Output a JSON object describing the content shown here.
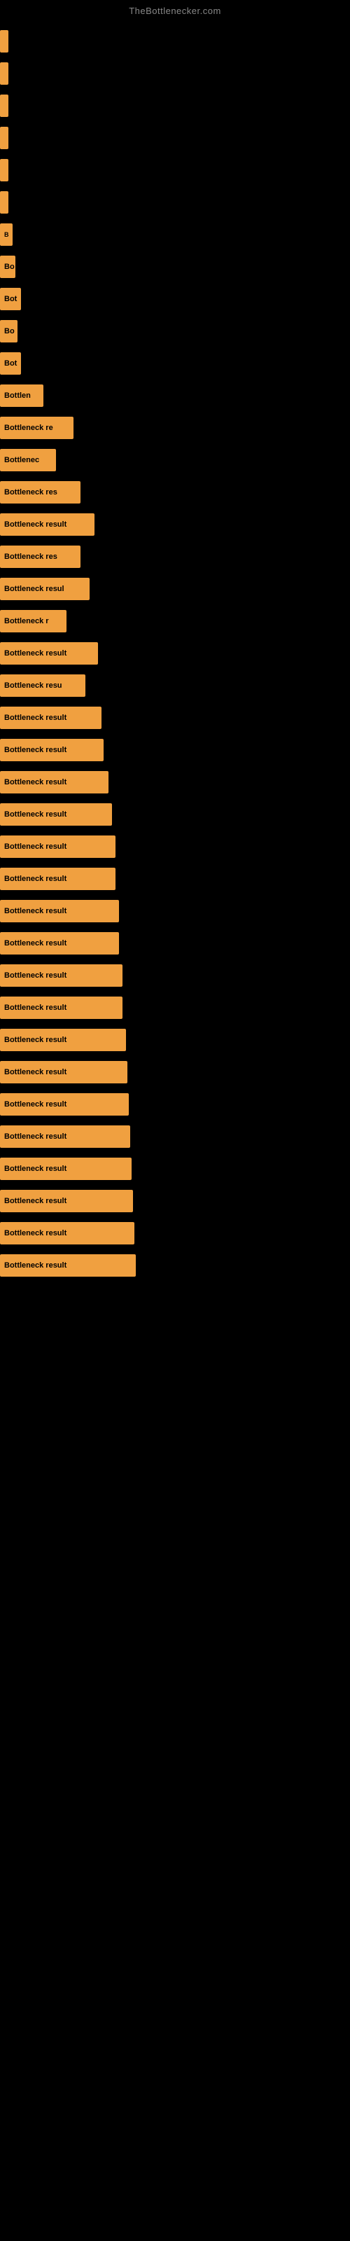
{
  "site": {
    "title": "TheBottlenecker.com"
  },
  "bars": [
    {
      "id": 1,
      "label": "",
      "width": 5
    },
    {
      "id": 2,
      "label": "",
      "width": 8
    },
    {
      "id": 3,
      "label": "",
      "width": 10
    },
    {
      "id": 4,
      "label": "",
      "width": 8
    },
    {
      "id": 5,
      "label": "",
      "width": 8
    },
    {
      "id": 6,
      "label": "",
      "width": 10
    },
    {
      "id": 7,
      "label": "B",
      "width": 18
    },
    {
      "id": 8,
      "label": "Bo",
      "width": 22
    },
    {
      "id": 9,
      "label": "Bot",
      "width": 30
    },
    {
      "id": 10,
      "label": "Bo",
      "width": 25
    },
    {
      "id": 11,
      "label": "Bot",
      "width": 30
    },
    {
      "id": 12,
      "label": "Bottlen",
      "width": 62
    },
    {
      "id": 13,
      "label": "Bottleneck re",
      "width": 105
    },
    {
      "id": 14,
      "label": "Bottlenec",
      "width": 80
    },
    {
      "id": 15,
      "label": "Bottleneck res",
      "width": 115
    },
    {
      "id": 16,
      "label": "Bottleneck result",
      "width": 135
    },
    {
      "id": 17,
      "label": "Bottleneck res",
      "width": 115
    },
    {
      "id": 18,
      "label": "Bottleneck resul",
      "width": 128
    },
    {
      "id": 19,
      "label": "Bottleneck r",
      "width": 95
    },
    {
      "id": 20,
      "label": "Bottleneck result",
      "width": 140
    },
    {
      "id": 21,
      "label": "Bottleneck resu",
      "width": 122
    },
    {
      "id": 22,
      "label": "Bottleneck result",
      "width": 145
    },
    {
      "id": 23,
      "label": "Bottleneck result",
      "width": 148
    },
    {
      "id": 24,
      "label": "Bottleneck result",
      "width": 155
    },
    {
      "id": 25,
      "label": "Bottleneck result",
      "width": 160
    },
    {
      "id": 26,
      "label": "Bottleneck result",
      "width": 165
    },
    {
      "id": 27,
      "label": "Bottleneck result",
      "width": 165
    },
    {
      "id": 28,
      "label": "Bottleneck result",
      "width": 170
    },
    {
      "id": 29,
      "label": "Bottleneck result",
      "width": 170
    },
    {
      "id": 30,
      "label": "Bottleneck result",
      "width": 175
    },
    {
      "id": 31,
      "label": "Bottleneck result",
      "width": 175
    },
    {
      "id": 32,
      "label": "Bottleneck result",
      "width": 180
    },
    {
      "id": 33,
      "label": "Bottleneck result",
      "width": 182
    },
    {
      "id": 34,
      "label": "Bottleneck result",
      "width": 184
    },
    {
      "id": 35,
      "label": "Bottleneck result",
      "width": 186
    },
    {
      "id": 36,
      "label": "Bottleneck result",
      "width": 188
    },
    {
      "id": 37,
      "label": "Bottleneck result",
      "width": 190
    },
    {
      "id": 38,
      "label": "Bottleneck result",
      "width": 192
    },
    {
      "id": 39,
      "label": "Bottleneck result",
      "width": 194
    }
  ]
}
